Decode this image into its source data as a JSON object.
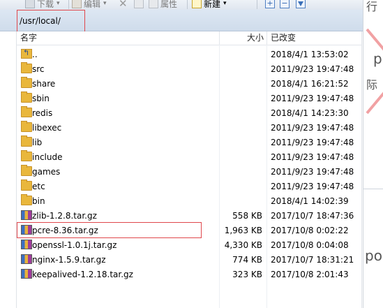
{
  "toolbar": {
    "download": "下载",
    "edit": "编辑",
    "properties": "属性",
    "new": "新建"
  },
  "path": "/usr/local/",
  "columns": {
    "name": "名字",
    "size": "大小",
    "modified": "已改变"
  },
  "rows": [
    {
      "name": "..",
      "size": "",
      "date": "2018/4/1 13:53:02",
      "icon": "parent-folder-icon"
    },
    {
      "name": "src",
      "size": "",
      "date": "2011/9/23 19:47:48",
      "icon": "folder-icon"
    },
    {
      "name": "share",
      "size": "",
      "date": "2018/4/1 16:21:52",
      "icon": "folder-icon"
    },
    {
      "name": "sbin",
      "size": "",
      "date": "2011/9/23 19:47:48",
      "icon": "folder-icon"
    },
    {
      "name": "redis",
      "size": "",
      "date": "2018/4/1 14:23:30",
      "icon": "folder-icon"
    },
    {
      "name": "libexec",
      "size": "",
      "date": "2011/9/23 19:47:48",
      "icon": "folder-icon"
    },
    {
      "name": "lib",
      "size": "",
      "date": "2011/9/23 19:47:48",
      "icon": "folder-icon"
    },
    {
      "name": "include",
      "size": "",
      "date": "2011/9/23 19:47:48",
      "icon": "folder-icon"
    },
    {
      "name": "games",
      "size": "",
      "date": "2011/9/23 19:47:48",
      "icon": "folder-icon"
    },
    {
      "name": "etc",
      "size": "",
      "date": "2011/9/23 19:47:48",
      "icon": "folder-icon"
    },
    {
      "name": "bin",
      "size": "",
      "date": "2018/4/1 14:02:39",
      "icon": "folder-icon"
    },
    {
      "name": "zlib-1.2.8.tar.gz",
      "size": "558 KB",
      "date": "2017/10/7 18:47:36",
      "icon": "archive-icon"
    },
    {
      "name": "pcre-8.36.tar.gz",
      "size": "1,963 KB",
      "date": "2017/10/8 0:02:22",
      "icon": "archive-icon"
    },
    {
      "name": "openssl-1.0.1j.tar.gz",
      "size": "4,330 KB",
      "date": "2017/10/8 0:04:08",
      "icon": "archive-icon"
    },
    {
      "name": "nginx-1.5.9.tar.gz",
      "size": "774 KB",
      "date": "2017/10/7 18:31:21",
      "icon": "archive-icon"
    },
    {
      "name": "keepalived-1.2.18.tar.gz",
      "size": "323 KB",
      "date": "2017/10/8 2:01:43",
      "icon": "archive-icon"
    }
  ],
  "right_fragments": {
    "a": "行",
    "b": "p",
    "c": "际",
    "d": "po"
  }
}
